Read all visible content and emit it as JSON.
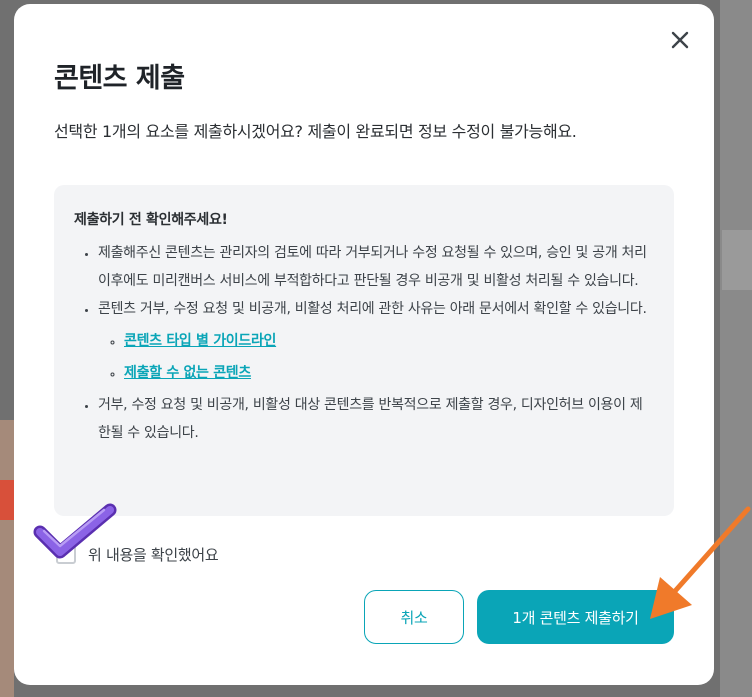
{
  "dialog": {
    "title": "콘텐츠 제출",
    "description": "선택한 1개의 요소를 제출하시겠어요? 제출이 완료되면 정보 수정이 불가능해요.",
    "close_icon": "close-icon"
  },
  "notice": {
    "heading": "제출하기 전 확인해주세요!",
    "items": [
      "제출해주신 콘텐츠는 관리자의 검토에 따라 거부되거나 수정 요청될 수 있으며, 승인 및 공개 처리 이후에도 미리캔버스 서비스에 부적합하다고 판단될 경우 비공개 및 비활성 처리될 수 있습니다.",
      "콘텐츠 거부, 수정 요청 및 비공개, 비활성 처리에 관한 사유는 아래 문서에서 확인할 수 있습니다.",
      "거부, 수정 요청 및 비공개, 비활성 대상 콘텐츠를 반복적으로 제출할 경우, 디자인허브 이용이 제한될 수 있습니다."
    ],
    "links": [
      "콘텐츠 타입 별 가이드라인",
      "제출할 수 없는 콘텐츠"
    ]
  },
  "confirm_checkbox": {
    "label": "위 내용을 확인했어요",
    "checked": false
  },
  "buttons": {
    "cancel": "취소",
    "submit": "1개 콘텐츠 제출하기"
  },
  "colors": {
    "accent": "#0aa5b7",
    "annotation_check": "#7b4fd6",
    "annotation_arrow": "#f07a2a"
  }
}
